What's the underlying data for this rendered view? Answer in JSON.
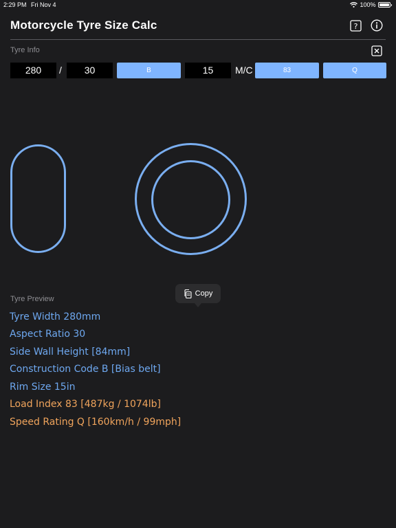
{
  "status": {
    "time": "2:29 PM",
    "date": "Fri Nov 4",
    "battery": "100%"
  },
  "header": {
    "title": "Motorcycle Tyre Size Calc"
  },
  "tyre_info": {
    "label": "Tyre Info",
    "width": "280",
    "slash": "/",
    "aspect": "30",
    "construction": "B",
    "rim": "15",
    "mc": "M/C",
    "load": "83",
    "speed": "Q"
  },
  "copy_label": "Copy",
  "preview": {
    "label": "Tyre Preview",
    "lines": [
      "Tyre Width 280mm",
      "Aspect Ratio 30",
      "Side Wall Height [84mm]",
      "Construction Code B [Bias belt]",
      "Rim Size 15in",
      "Load Index 83 [487kg / 1074lb]",
      "Speed Rating Q [160km/h / 99mph]"
    ]
  },
  "colors": {
    "accent": "#7fb5ff",
    "outline": "#7aaef0",
    "info_text": "#6ea8f0",
    "rating_text": "#f0a45c",
    "background": "#1c1c1e"
  }
}
